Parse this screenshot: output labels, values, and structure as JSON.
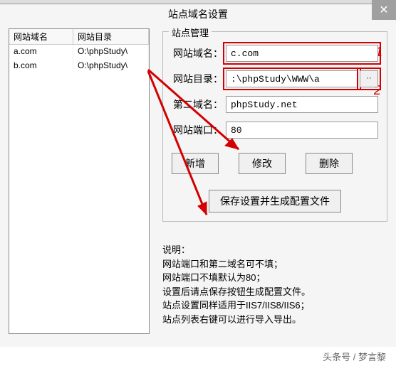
{
  "window": {
    "title": "站点域名设置"
  },
  "table": {
    "headers": [
      "网站域名",
      "网站目录"
    ],
    "rows": [
      {
        "domain": "a.com",
        "dir": "O:\\phpStudy\\"
      },
      {
        "domain": "b.com",
        "dir": "O:\\phpStudy\\"
      }
    ]
  },
  "panel": {
    "legend": "站点管理",
    "labels": {
      "domain": "网站域名：",
      "dir": "网站目录：",
      "second": "第二域名：",
      "port": "网站端口："
    },
    "values": {
      "domain": "c.com",
      "dir": ":\\phpStudy\\WWW\\a",
      "second": "phpStudy.net",
      "port": "80"
    },
    "browse": "··",
    "buttons": {
      "add": "新增",
      "edit": "修改",
      "delete": "删除",
      "save": "保存设置并生成配置文件"
    },
    "markers": {
      "m1": "1",
      "m2": "2"
    }
  },
  "note": {
    "title": "说明：",
    "lines": [
      "网站端口和第二域名可不填；",
      "网站端口不填默认为80；",
      "设置后请点保存按钮生成配置文件。",
      "站点设置同样适用于IIS7/IIS8/IIS6；",
      "站点列表右键可以进行导入导出。"
    ]
  },
  "footer": "头条号 / 梦言黎"
}
